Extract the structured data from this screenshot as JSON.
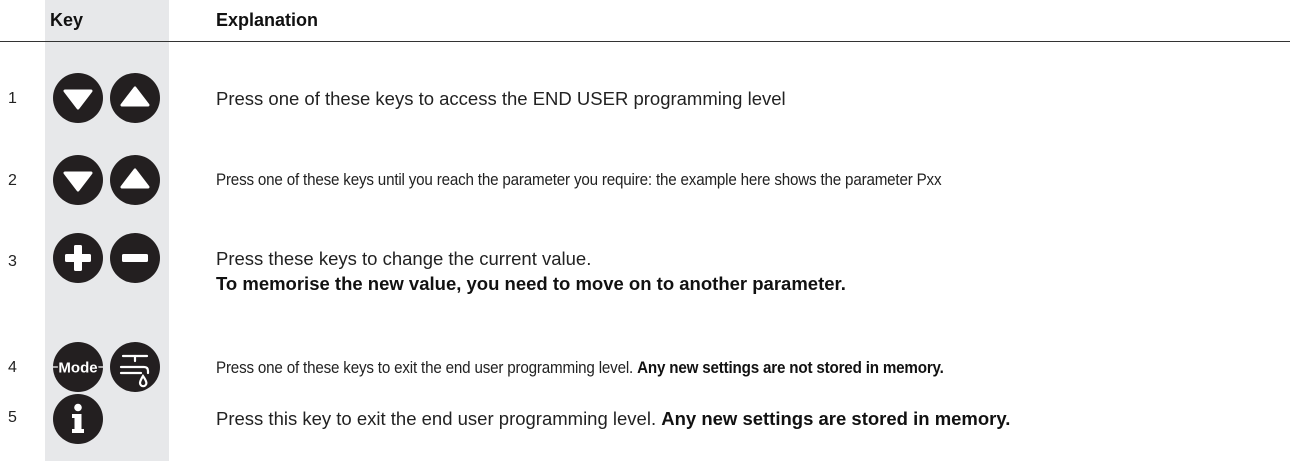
{
  "header": {
    "key_label": "Key",
    "explanation_label": "Explanation"
  },
  "rows": [
    {
      "number": "1",
      "keys": [
        "arrow-down-icon",
        "arrow-up-icon"
      ],
      "text": "Press one of these keys to access the END USER programming level"
    },
    {
      "number": "2",
      "keys": [
        "arrow-down-icon",
        "arrow-up-icon"
      ],
      "text": "Press one of these keys until you reach the parameter you require: the example here shows the parameter Pxx"
    },
    {
      "number": "3",
      "keys": [
        "plus-icon",
        "minus-icon"
      ],
      "text": "Press these keys to change the current value.",
      "text_bold": "To memorise the new value, you need to move on to another parameter."
    },
    {
      "number": "4",
      "keys": [
        "mode-icon",
        "hot-water-tap-icon"
      ],
      "text": "Press one of these keys to exit the end user programming level. ",
      "text_bold": "Any new settings are not stored in memory."
    },
    {
      "number": "5",
      "keys": [
        "info-icon"
      ],
      "text": "Press this key to exit the end user programming level. ",
      "text_bold": "Any new settings are stored in memory."
    }
  ],
  "mode_key_label": "Mode",
  "info_key_label": "i"
}
